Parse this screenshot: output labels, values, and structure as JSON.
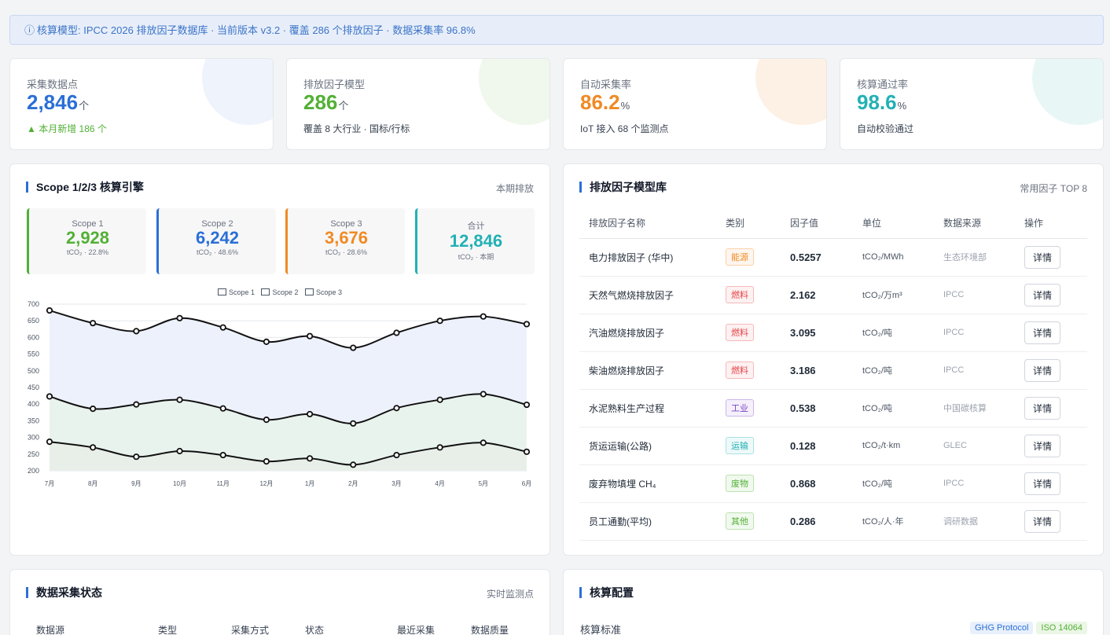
{
  "banner": {
    "icon": "info-icon",
    "text": "核算模型: IPCC 2026 排放因子数据库 · 当前版本 v3.2 · 覆盖 286 个排放因子 · 数据采集率 96.8%"
  },
  "stats": [
    {
      "label": "采集数据点",
      "value": "2,846",
      "unit": "个",
      "sub": "▲ 本月新增 186 个",
      "color": "#2b6fd6",
      "sub_color": "#52b035",
      "deco": "#eef3fc"
    },
    {
      "label": "排放因子模型",
      "value": "286",
      "unit": "个",
      "sub": "覆盖 8 大行业 · 国标/行标",
      "color": "#52b035",
      "sub_color": "#374151",
      "deco": "#f0f7ec"
    },
    {
      "label": "自动采集率",
      "value": "86.2",
      "unit": "%",
      "sub": "IoT 接入 68 个监测点",
      "color": "#f08a24",
      "sub_color": "#374151",
      "deco": "#fdf1e6"
    },
    {
      "label": "核算通过率",
      "value": "98.6",
      "unit": "%",
      "sub": "自动校验通过",
      "color": "#22b1b4",
      "sub_color": "#374151",
      "deco": "#e8f7f6"
    }
  ],
  "scope_panel": {
    "title": "Scope 1/2/3 核算引擎",
    "meta": "本期排放",
    "cards": [
      {
        "name": "Scope 1",
        "value": "2,928",
        "sub": "tCO₂ · 22.8%",
        "color": "#52b035"
      },
      {
        "name": "Scope 2",
        "value": "6,242",
        "sub": "tCO₂ · 48.6%",
        "color": "#2b6fd6"
      },
      {
        "name": "Scope 3",
        "value": "3,676",
        "sub": "tCO₂ · 28.6%",
        "color": "#f08a24"
      },
      {
        "name": "合计",
        "value": "12,846",
        "sub": "tCO₂ · 本期",
        "color": "#22b1b4"
      }
    ]
  },
  "chart_data": {
    "type": "area",
    "categories": [
      "7月",
      "8月",
      "9月",
      "10月",
      "11月",
      "12月",
      "1月",
      "2月",
      "3月",
      "4月",
      "5月",
      "6月"
    ],
    "ylim": [
      200,
      700
    ],
    "yticks": [
      200,
      250,
      300,
      350,
      400,
      450,
      500,
      550,
      600,
      650,
      700
    ],
    "grid": true,
    "stacked": true,
    "legend_position": "top-center",
    "series": [
      {
        "name": "Scope 1",
        "values": [
          287,
          270,
          242,
          259,
          247,
          228,
          237,
          218,
          247,
          270,
          284,
          257
        ],
        "fill": "#e8efe9"
      },
      {
        "name": "Scope 2",
        "values": [
          423,
          386,
          399,
          413,
          387,
          353,
          370,
          342,
          388,
          413,
          430,
          398
        ],
        "fill": "#e9f3ee"
      },
      {
        "name": "Scope 3",
        "values": [
          681,
          643,
          619,
          658,
          630,
          587,
          604,
          569,
          614,
          650,
          663,
          640
        ],
        "fill": "#edf1fc"
      }
    ]
  },
  "factor_panel": {
    "title": "排放因子模型库",
    "meta": "常用因子 TOP 8",
    "columns": [
      "排放因子名称",
      "类别",
      "因子值",
      "单位",
      "数据来源",
      "操作"
    ],
    "action_label": "详情",
    "rows": [
      {
        "name": "电力排放因子 (华中)",
        "cat": "能源",
        "cat_color": "#f08a24",
        "value": "0.5257",
        "unit": "tCO₂/MWh",
        "source": "生态环境部"
      },
      {
        "name": "天然气燃烧排放因子",
        "cat": "燃料",
        "cat_color": "#e5484d",
        "value": "2.162",
        "unit": "tCO₂/万m³",
        "source": "IPCC"
      },
      {
        "name": "汽油燃烧排放因子",
        "cat": "燃料",
        "cat_color": "#e5484d",
        "value": "3.095",
        "unit": "tCO₂/吨",
        "source": "IPCC"
      },
      {
        "name": "柴油燃烧排放因子",
        "cat": "燃料",
        "cat_color": "#e5484d",
        "value": "3.186",
        "unit": "tCO₂/吨",
        "source": "IPCC"
      },
      {
        "name": "水泥熟料生产过程",
        "cat": "工业",
        "cat_color": "#7b45c9",
        "value": "0.538",
        "unit": "tCO₂/吨",
        "source": "中国碳核算"
      },
      {
        "name": "货运运输(公路)",
        "cat": "运输",
        "cat_color": "#22b1b4",
        "value": "0.128",
        "unit": "tCO₂/t·km",
        "source": "GLEC"
      },
      {
        "name": "废弃物填埋 CH₄",
        "cat": "废物",
        "cat_color": "#52b035",
        "value": "0.868",
        "unit": "tCO₂/吨",
        "source": "IPCC"
      },
      {
        "name": "员工通勤(平均)",
        "cat": "其他",
        "cat_color": "#52b035",
        "value": "0.286",
        "unit": "tCO₂/人·年",
        "source": "调研数据"
      }
    ]
  },
  "collection_panel": {
    "title": "数据采集状态",
    "meta": "实时监测点",
    "columns": [
      "数据源",
      "类型",
      "采集方式",
      "状态",
      "最近采集",
      "数据质量"
    ]
  },
  "config_panel": {
    "title": "核算配置",
    "label": "核算标准",
    "tags": [
      {
        "text": "GHG Protocol",
        "color": "#2b6fd6",
        "bg": "#e8f0fb"
      },
      {
        "text": "ISO 14064",
        "color": "#52b035",
        "bg": "#ebf6e6"
      }
    ]
  }
}
